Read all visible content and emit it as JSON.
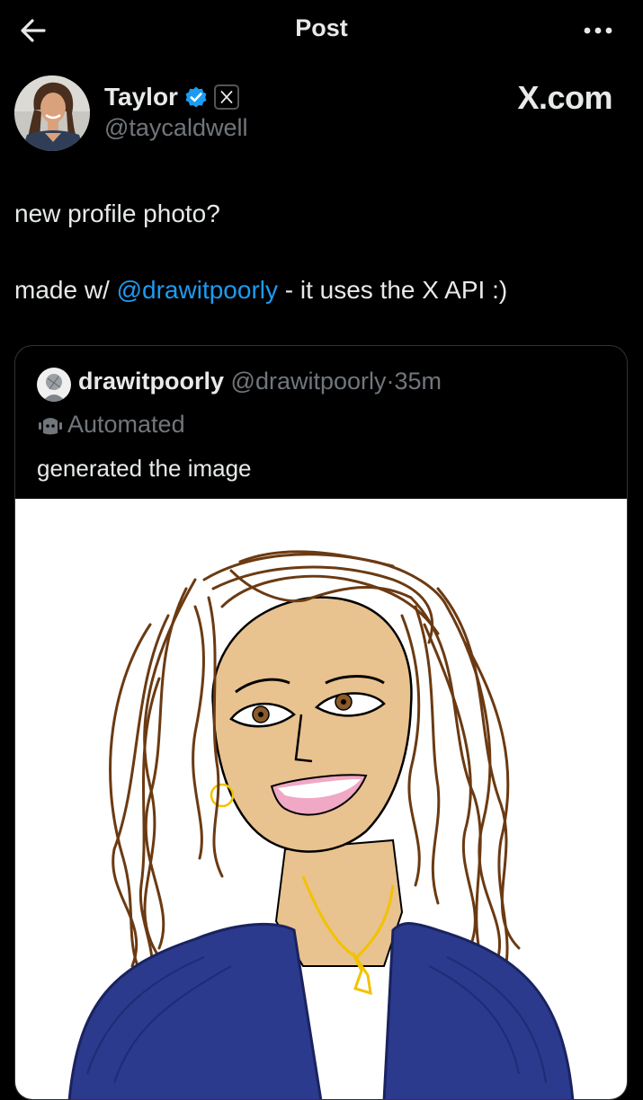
{
  "header": {
    "title": "Post",
    "back_icon": "arrow-left-icon",
    "more_icon": "more-horizontal-icon"
  },
  "author": {
    "display_name": "Taylor",
    "handle": "@taycaldwell",
    "verified_color": "#1d9bf0"
  },
  "watermark": "X.com",
  "post": {
    "line1": "new profile photo?",
    "line2_prefix": "made w/ ",
    "mention": "@drawitpoorly",
    "line2_suffix": " - it uses the X API :)"
  },
  "quote": {
    "display_name": "drawitpoorly",
    "handle": "@drawitpoorly",
    "separator": "·",
    "time": "35m",
    "automated_label": "Automated",
    "text": "generated the image"
  },
  "colors": {
    "background": "#000000",
    "text": "#e7e9ea",
    "secondary": "#71767b",
    "accent": "#1d9bf0",
    "border": "#2f3336"
  }
}
